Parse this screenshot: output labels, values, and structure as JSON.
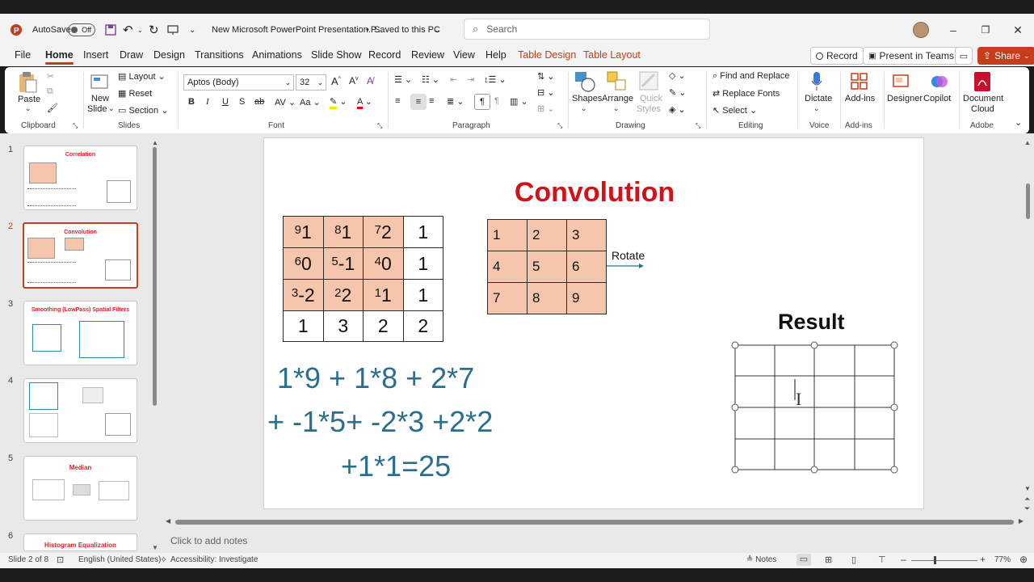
{
  "titlebar": {
    "autosave_label": "AutoSave",
    "autosave_state": "Off",
    "doc_title": "New Microsoft PowerPoint Presentation.P...",
    "save_status": "Saved to this PC",
    "search_placeholder": "Search"
  },
  "menu": {
    "file": "File",
    "home": "Home",
    "insert": "Insert",
    "draw": "Draw",
    "design": "Design",
    "transitions": "Transitions",
    "animations": "Animations",
    "slideshow": "Slide Show",
    "record": "Record",
    "review": "Review",
    "view": "View",
    "help": "Help",
    "table_design": "Table Design",
    "table_layout": "Table Layout",
    "record_btn": "Record",
    "present_teams": "Present in Teams",
    "share": "Share"
  },
  "ribbon": {
    "paste": "Paste",
    "clipboard": "Clipboard",
    "new_slide_1": "New",
    "new_slide_2": "Slide",
    "layout": "Layout",
    "reset": "Reset",
    "section": "Section",
    "slides": "Slides",
    "font_name": "Aptos (Body)",
    "font_size": "32",
    "font": "Font",
    "paragraph": "Paragraph",
    "shapes": "Shapes",
    "arrange": "Arrange",
    "quick_styles_1": "Quick",
    "quick_styles_2": "Styles",
    "drawing": "Drawing",
    "find_replace": "Find and Replace",
    "replace_fonts": "Replace Fonts",
    "select": "Select",
    "editing": "Editing",
    "dictate": "Dictate",
    "voice": "Voice",
    "addins": "Add-ins",
    "addins_group": "Add-ins",
    "designer": "Designer",
    "copilot": "Copilot",
    "doc_cloud_1": "Document",
    "doc_cloud_2": "Cloud",
    "adobe": "Adobe"
  },
  "thumbnails": [
    {
      "num": "1",
      "title": "Correlation"
    },
    {
      "num": "2",
      "title": "Convolution"
    },
    {
      "num": "3",
      "title": "Smoothing (LowPass) Spatial Filters"
    },
    {
      "num": "4",
      "title": ""
    },
    {
      "num": "5",
      "title": "Median"
    },
    {
      "num": "6",
      "title": "Histogram Equalization"
    }
  ],
  "slide": {
    "title": "Convolution",
    "image_grid": [
      [
        {
          "k": "9",
          "v": "1"
        },
        {
          "k": "8",
          "v": "1"
        },
        {
          "k": "7",
          "v": "2"
        },
        {
          "k": "",
          "v": "1"
        }
      ],
      [
        {
          "k": "6",
          "v": "0"
        },
        {
          "k": "5",
          "v": "-1"
        },
        {
          "k": "4",
          "v": "0"
        },
        {
          "k": "",
          "v": "1"
        }
      ],
      [
        {
          "k": "3",
          "v": "-2"
        },
        {
          "k": "2",
          "v": "2"
        },
        {
          "k": "1",
          "v": "1"
        },
        {
          "k": "",
          "v": "1"
        }
      ],
      [
        {
          "k": "",
          "v": "1"
        },
        {
          "k": "",
          "v": "3"
        },
        {
          "k": "",
          "v": "2"
        },
        {
          "k": "",
          "v": "2"
        }
      ]
    ],
    "kernel": [
      [
        "1",
        "2",
        "3"
      ],
      [
        "4",
        "5",
        "6"
      ],
      [
        "7",
        "8",
        "9"
      ]
    ],
    "rotate_label": "Rotate",
    "result_label": "Result",
    "equation_1": "1*9  + 1*8 + 2*7",
    "equation_2": "+ -1*5+ -2*3 +2*2",
    "equation_3": "+1*1=25"
  },
  "notes_placeholder": "Click to add notes",
  "status": {
    "slide_info": "Slide 2 of 8",
    "language": "English (United States)",
    "accessibility": "Accessibility: Investigate",
    "notes": "Notes",
    "zoom": "77%"
  },
  "colors": {
    "accent": "#c43e1c",
    "title_red": "#d0121b",
    "peach": "#f5c6ac",
    "equation_blue": "#2a6f8c"
  }
}
